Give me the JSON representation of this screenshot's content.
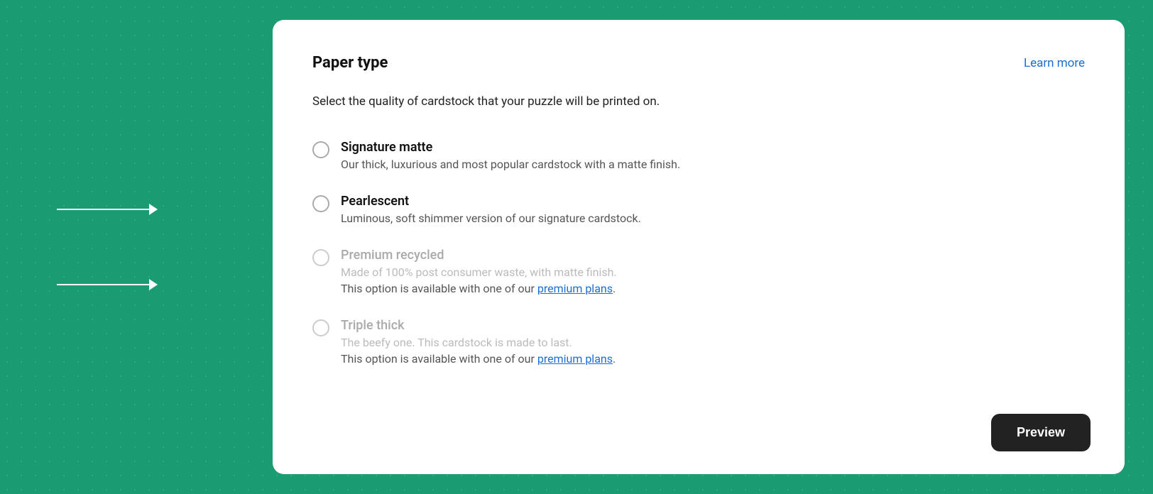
{
  "background": {
    "color": "#1a9b72"
  },
  "panel": {
    "title": "Paper type",
    "learn_more": "Learn more",
    "subtitle": "Select the quality of cardstock that your puzzle will be printed on.",
    "options": [
      {
        "id": "signature-matte",
        "label": "Signature matte",
        "description": "Our thick, luxurious and most popular cardstock with a matte finish.",
        "disabled": false,
        "premium": false
      },
      {
        "id": "pearlescent",
        "label": "Pearlescent",
        "description": "Luminous, soft shimmer version of our signature cardstock.",
        "disabled": false,
        "premium": false
      },
      {
        "id": "premium-recycled",
        "label": "Premium recycled",
        "description": "Made of 100% post consumer waste, with matte finish.",
        "disabled": true,
        "premium": true,
        "premium_text_pre": "This option is available with one of our ",
        "premium_link_text": "premium plans",
        "premium_text_post": "."
      },
      {
        "id": "triple-thick",
        "label": "Triple thick",
        "description": "The beefy one. This cardstock is made to last.",
        "disabled": true,
        "premium": true,
        "premium_text_pre": "This option is available with one of our ",
        "premium_link_text": "premium plans",
        "premium_text_post": "."
      }
    ],
    "preview_button": "Preview"
  }
}
